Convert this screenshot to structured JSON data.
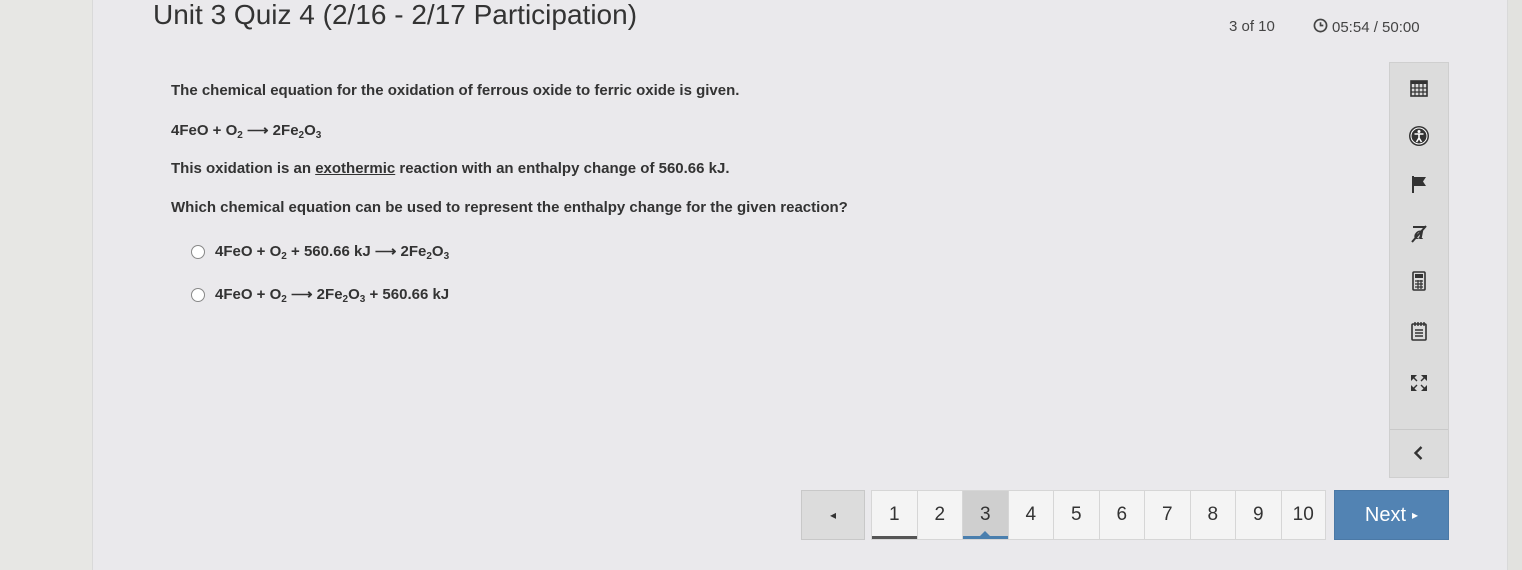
{
  "quiz": {
    "title": "Unit 3 Quiz 4 (2/16 - 2/17 Participation)",
    "progress": "3 of 10",
    "timer": "05:54 / 50:00"
  },
  "question": {
    "intro": "The chemical equation for the oxidation of ferrous oxide to ferric oxide is given.",
    "equation": {
      "p1": "4FeO + O",
      "s1": "2",
      "p2": " ⟶ 2Fe",
      "s2": "2",
      "p3": "O",
      "s3": "3"
    },
    "statement": {
      "before": "This oxidation is an ",
      "emph": "exothermic",
      "after": " reaction with an enthalpy change of 560.66 kJ."
    },
    "prompt": "Which chemical equation can be used to represent the enthalpy change for the given reaction?",
    "options": [
      {
        "p1": "4FeO + O",
        "s1": "2",
        "p2": " + 560.66 kJ ⟶ 2Fe",
        "s2": "2",
        "p3": "O",
        "s3": "3",
        "p4": ""
      },
      {
        "p1": "4FeO + O",
        "s1": "2",
        "p2": " ⟶ 2Fe",
        "s2": "2",
        "p3": "O",
        "s3": "3",
        "p4": " + 560.66 kJ"
      }
    ]
  },
  "toolbar": {
    "tools": [
      "calendar-icon",
      "accessibility-icon",
      "flag-icon",
      "text-strike-icon",
      "calculator-icon",
      "notepad-icon",
      "fullscreen-icon"
    ],
    "collapse": "chevron-left-icon"
  },
  "pager": {
    "prev": "◂",
    "pages": [
      "1",
      "2",
      "3",
      "4",
      "5",
      "6",
      "7",
      "8",
      "9",
      "10"
    ],
    "current": "3",
    "next_label": "Next",
    "next_arrow": "▸"
  },
  "colors": {
    "accent": "#5283b3",
    "background": "#eae9ec"
  }
}
